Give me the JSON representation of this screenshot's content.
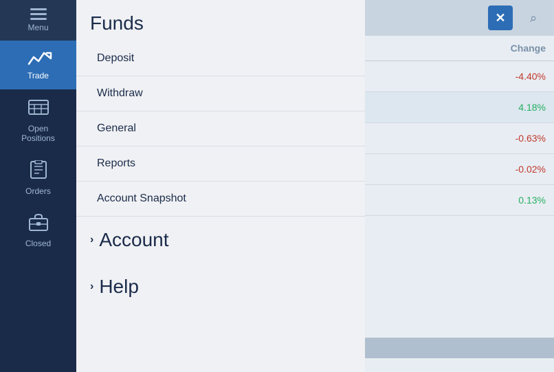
{
  "sidebar": {
    "items": [
      {
        "id": "menu",
        "label": "Menu",
        "icon": "hamburger",
        "active": false
      },
      {
        "id": "trade",
        "label": "Trade",
        "icon": "trade",
        "active": true
      },
      {
        "id": "open-positions",
        "label": "Open\nPositions",
        "icon": "positions",
        "active": false
      },
      {
        "id": "orders",
        "label": "Orders",
        "icon": "orders",
        "active": false
      },
      {
        "id": "closed",
        "label": "Closed",
        "icon": "briefcase",
        "active": false
      }
    ]
  },
  "funds_panel": {
    "title": "Funds",
    "menu_items": [
      {
        "id": "deposit",
        "label": "Deposit"
      },
      {
        "id": "withdraw",
        "label": "Withdraw"
      },
      {
        "id": "general",
        "label": "General"
      },
      {
        "id": "reports",
        "label": "Reports"
      },
      {
        "id": "account-snapshot",
        "label": "Account Snapshot"
      }
    ],
    "sections": [
      {
        "id": "account",
        "label": "Account"
      },
      {
        "id": "help",
        "label": "Help"
      }
    ]
  },
  "data_panel": {
    "close_button_label": "✕",
    "search_button_label": "🔍",
    "table": {
      "columns": [
        {
          "id": "change",
          "label": "Change"
        }
      ],
      "rows": [
        {
          "change": "-4.40%",
          "type": "negative",
          "highlight": false
        },
        {
          "change": "4.18%",
          "type": "positive",
          "highlight": true
        },
        {
          "change": "-0.63%",
          "type": "negative",
          "highlight": false
        },
        {
          "change": "-0.02%",
          "type": "negative",
          "highlight": false
        },
        {
          "change": "0.13%",
          "type": "positive",
          "highlight": false
        }
      ]
    }
  }
}
